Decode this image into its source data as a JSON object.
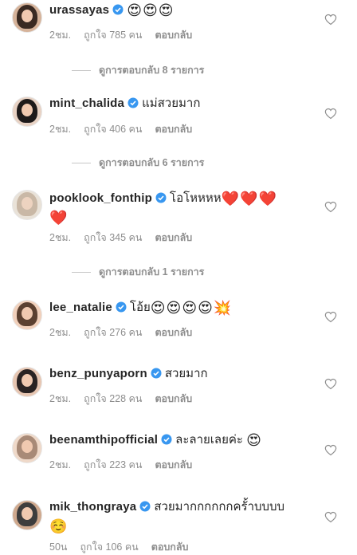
{
  "comments": [
    {
      "username": "urassayas",
      "text": "",
      "emojis": [
        "😍",
        "😍",
        "😍"
      ],
      "time": "2ชม.",
      "likes": "ถูกใจ 785 คน",
      "reply": "ตอบกลับ",
      "view_replies": "ดูการตอบกลับ 8 รายการ",
      "avatar_colors": [
        "#3a2a22",
        "#d6b39a"
      ]
    },
    {
      "username": "mint_chalida",
      "text": "แม่สวยมาก",
      "emojis": [],
      "time": "2ชม.",
      "likes": "ถูกใจ 406 คน",
      "reply": "ตอบกลับ",
      "view_replies": "ดูการตอบกลับ 6 รายการ",
      "avatar_colors": [
        "#1e1a1a",
        "#e8d2c4"
      ]
    },
    {
      "username": "pooklook_fonthip",
      "text": "โอโหหหห",
      "emojis": [
        "❤️",
        "❤️",
        "❤️",
        "❤️"
      ],
      "time": "2ชม.",
      "likes": "ถูกใจ 345 คน",
      "reply": "ตอบกลับ",
      "view_replies": "ดูการตอบกลับ 1 รายการ",
      "avatar_colors": [
        "#e9e2d8",
        "#edd3c0"
      ]
    },
    {
      "username": "lee_natalie",
      "text": "โอ้ย",
      "emojis": [
        "😍",
        "😍",
        "😍",
        "😍",
        "💥"
      ],
      "time": "2ชม.",
      "likes": "ถูกใจ 276 คน",
      "reply": "ตอบกลับ",
      "avatar_colors": [
        "#5b4030",
        "#f1d0bb"
      ]
    },
    {
      "username": "benz_punyaporn",
      "text": "สวยมาก",
      "emojis": [],
      "time": "2ชม.",
      "likes": "ถูกใจ 228 คน",
      "reply": "ตอบกลับ",
      "avatar_colors": [
        "#2a2323",
        "#e7c6b2"
      ]
    },
    {
      "username": "beenamthipofficial",
      "text": "ละลายเลยค่ะ",
      "emojis": [
        "😍"
      ],
      "time": "2ชม.",
      "likes": "ถูกใจ 223 คน",
      "reply": "ตอบกลับ",
      "avatar_colors": [
        "#a88a77",
        "#efd9c9"
      ]
    },
    {
      "username": "mik_thongraya",
      "text": "สวยมากกกกกกครั้าบบบบ",
      "emojis": [
        "☺️"
      ],
      "time": "50น",
      "likes": "ถูกใจ 106 คน",
      "reply": "ตอบกลับ",
      "avatar_colors": [
        "#3d3d3d",
        "#cfa98e"
      ]
    }
  ],
  "icons": {
    "verified": "verified-badge-icon",
    "like": "heart-outline-icon"
  },
  "colors": {
    "verified": "#3897f0",
    "muted": "#8e8e8e",
    "text": "#262626"
  }
}
